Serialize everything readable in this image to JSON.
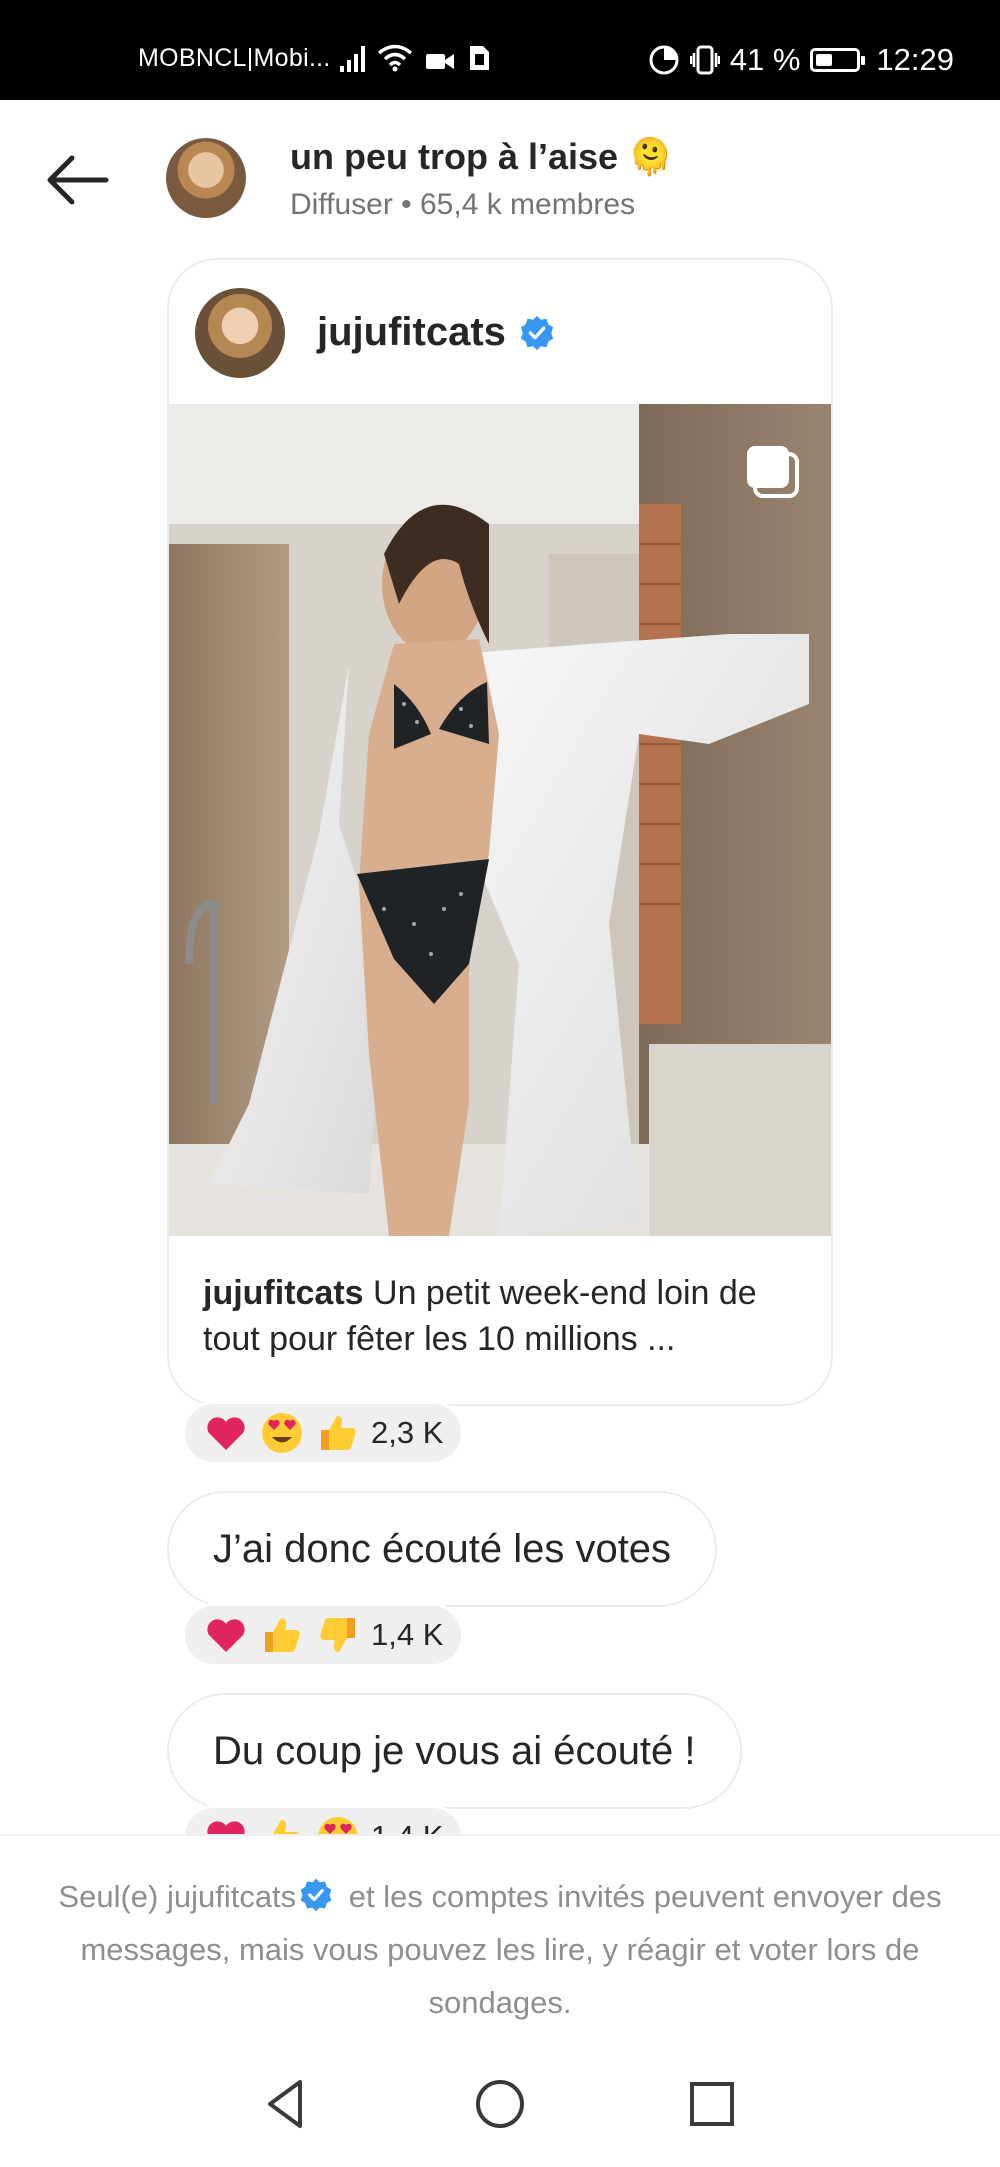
{
  "status_bar": {
    "carrier": "MOBNCL|Mobi...",
    "battery_percent": "41 %",
    "time": "12:29",
    "battery_level": 0.41
  },
  "header": {
    "channel_name": "un peu trop à l’aise 🫠",
    "subtitle": "Diffuser • 65,4 k membres"
  },
  "post": {
    "username": "jujufitcats",
    "caption_user": "jujufitcats",
    "caption_text": " Un petit week-end loin de tout pour fêter les 10 millions ..."
  },
  "reactions": [
    {
      "emojis": [
        "heart",
        "heart-eyes",
        "thumbs-up"
      ],
      "count": "2,3 K"
    },
    {
      "emojis": [
        "heart",
        "thumbs-up",
        "thumbs-down"
      ],
      "count": "1,4 K"
    },
    {
      "emojis": [
        "heart",
        "thumbs-up",
        "heart-eyes"
      ],
      "count": "1,4 K"
    }
  ],
  "messages": [
    {
      "text": "J’ai donc écouté les votes"
    },
    {
      "text": "Du coup je vous ai écouté !"
    }
  ],
  "notice": {
    "part1": "Seul(e) jujufitcats",
    "part2": " et les comptes invités peuvent envoyer des messages, mais vous pouvez les lire, y réagir et voter lors de sondages."
  },
  "colors": {
    "verified_blue": "#3897f0",
    "heart_red": "#e0245e",
    "emoji_yellow": "#ffcc33"
  }
}
